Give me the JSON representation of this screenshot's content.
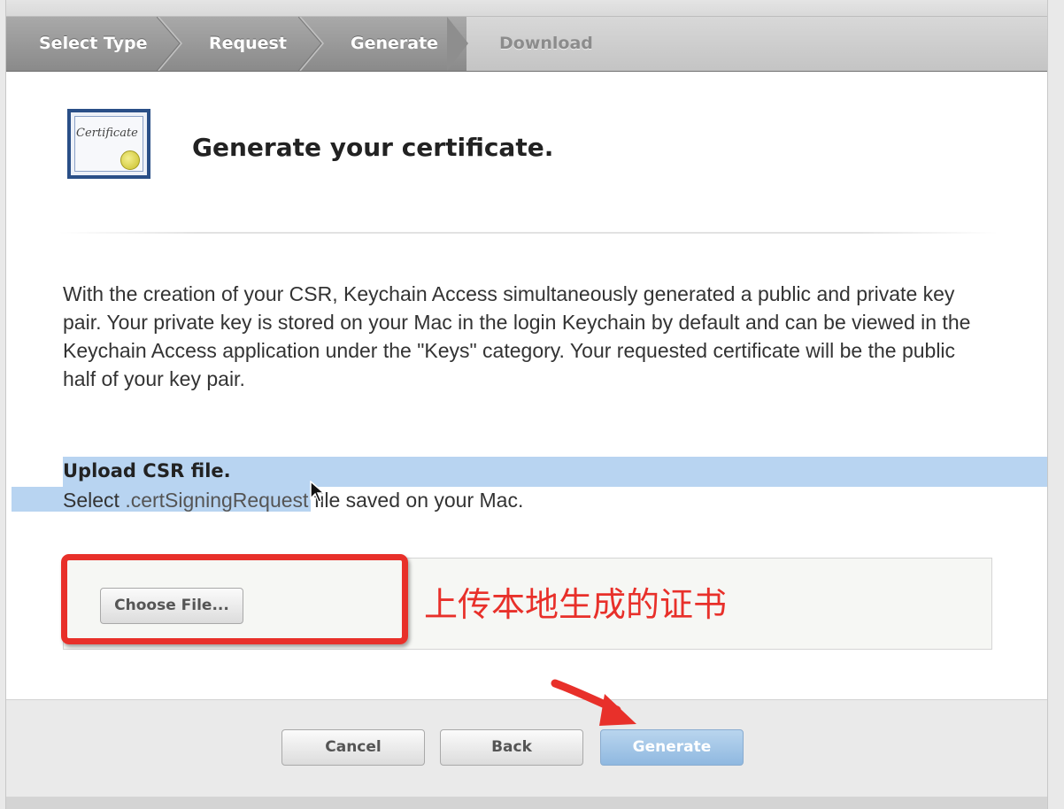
{
  "steps": {
    "items": [
      {
        "label": "Select Type"
      },
      {
        "label": "Request"
      },
      {
        "label": "Generate"
      },
      {
        "label": "Download"
      }
    ]
  },
  "cert_icon_text": "Certificate",
  "page_title": "Generate your certificate.",
  "description": "With the creation of your CSR, Keychain Access simultaneously generated a public and private key pair. Your private key is stored on your Mac in the login Keychain by default and can be viewed in the Keychain Access application under the \"Keys\" category. Your requested certificate will be the public half of your key pair.",
  "upload": {
    "title": "Upload CSR file.",
    "sub_prefix": "Select ",
    "sub_code": ".certSigningRequest",
    "sub_suffix": " file saved on your Mac.",
    "choose_label": "Choose File..."
  },
  "annotation": "上传本地生成的证书",
  "footer": {
    "cancel_label": "Cancel",
    "back_label": "Back",
    "generate_label": "Generate"
  },
  "colors": {
    "annotation_red": "#e8302a",
    "selection_blue": "#b8d4f1",
    "generate_button": "#a6c8ea"
  }
}
